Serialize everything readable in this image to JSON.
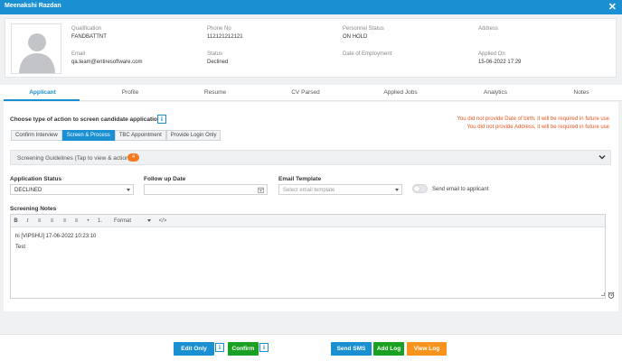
{
  "window": {
    "title": "Meenakshi Razdan",
    "close_glyph": "✕"
  },
  "candidate": {
    "qualification": {
      "label": "Qualification",
      "value": "FANDBATTNT"
    },
    "phone": {
      "label": "Phone No",
      "value": "112121212121"
    },
    "personnel_status": {
      "label": "Personnel Status",
      "value": "ON HOLD"
    },
    "address": {
      "label": "Address",
      "value": ""
    },
    "email": {
      "label": "Email",
      "value": "qa.team@entiresoftware.com"
    },
    "status": {
      "label": "Status",
      "value": "Declined"
    },
    "date_of_employment": {
      "label": "Date of Employment",
      "value": ""
    },
    "applied_on": {
      "label": "Applied On",
      "value": "15-06-2022 17:29"
    }
  },
  "tabs": [
    {
      "label": "Applicant",
      "active": true
    },
    {
      "label": "Profile"
    },
    {
      "label": "Resume"
    },
    {
      "label": "CV Parsed"
    },
    {
      "label": "Applied Jobs"
    },
    {
      "label": "Analytics"
    },
    {
      "label": "Notes"
    }
  ],
  "screening": {
    "action_heading": "Choose type of action to screen candidate application",
    "info_glyph": "i",
    "actions": [
      {
        "label": "Confirm Interview"
      },
      {
        "label": "Screen & Process",
        "active": true
      },
      {
        "label": "TBC Appointment"
      },
      {
        "label": "Provide Login Only"
      }
    ],
    "warnings": [
      "You did not provide Date of birth, it will be required in future use",
      "You did not provide Address, it will be required in future use"
    ],
    "guidelines": {
      "label": "Screening Guidelines (Tap to view & action)",
      "count": "4"
    },
    "application_status": {
      "label": "Application Status",
      "value": "DECLINED"
    },
    "follow_up": {
      "label": "Follow up Date",
      "value": ""
    },
    "email_template": {
      "label": "Email Template",
      "placeholder": "Select email template"
    },
    "send_email": {
      "label": "Send email to applicant",
      "on": false
    },
    "notes": {
      "label": "Screening Notes",
      "format_label": "Format",
      "toolbar": [
        "B",
        "I",
        "≡",
        "≡",
        "≡",
        "≡",
        "•",
        "1.",
        "</>"
      ],
      "lines": [
        "hi   [VIPSHU] 17-06-2022 10:23:10",
        "Test"
      ]
    }
  },
  "footer": {
    "edit_only": "Edit Only",
    "confirm": "Confirm",
    "send_sms": "Send SMS",
    "add_log": "Add Log",
    "view_log": "View Log",
    "info_glyph": "i"
  },
  "colors": {
    "primary": "#1a8fd1",
    "green": "#1aa124",
    "orange": "#f7941d",
    "warning_text": "#e8561f",
    "badge": "#f47920"
  },
  "icons": {
    "close": "close-icon",
    "avatar": "user-avatar-icon",
    "chevron": "chevron-down-icon",
    "calendar": "calendar-icon",
    "alarm": "alarm-clock-icon"
  }
}
